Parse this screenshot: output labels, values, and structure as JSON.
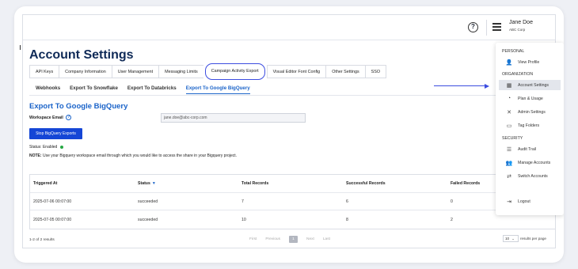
{
  "header": {
    "help_icon": "question-circle-icon",
    "menu_icon": "hamburger-icon",
    "user_name": "Jane Doe",
    "user_company": "ABC Corp"
  },
  "page": {
    "title": "Account Settings"
  },
  "tabs": [
    {
      "label": "API Keys",
      "active": false
    },
    {
      "label": "Company Information",
      "active": false
    },
    {
      "label": "User Management",
      "active": false
    },
    {
      "label": "Messaging Limits",
      "active": false
    },
    {
      "label": "Campaign Activity Export",
      "active": true
    },
    {
      "label": "Visual Editor Font Config",
      "active": false
    },
    {
      "label": "Other Settings",
      "active": false
    },
    {
      "label": "SSO",
      "active": false
    }
  ],
  "subtabs": [
    {
      "label": "Webhooks",
      "active": false
    },
    {
      "label": "Export To Snowflake",
      "active": false
    },
    {
      "label": "Export To Databricks",
      "active": false
    },
    {
      "label": "Export To Google BigQuery",
      "active": true
    }
  ],
  "export": {
    "title": "Export To Google BigQuery",
    "workspace_email_label": "Workspace Email",
    "workspace_email_value": "jane.doe@abc-corp.com",
    "stop_button_label": "Stop BigQuery Exports",
    "status_label": "Status:",
    "status_value": "Enabled",
    "status_color": "#27a844",
    "note_label": "NOTE:",
    "note_text": "Use your Bigquery workspace email through which you would like to access the share in your Bigquery project."
  },
  "table": {
    "columns": [
      "Triggered At",
      "Status",
      "Total Records",
      "Successful Records",
      "Failed Records"
    ],
    "rows": [
      [
        "2025-07-06 00:07:00",
        "succeeded",
        "7",
        "6",
        "0"
      ],
      [
        "2025-07-05 00:07:00",
        "succeeded",
        "10",
        "8",
        "2"
      ]
    ]
  },
  "pagination": {
    "range_text": "1-2 of 2 results",
    "first": "First",
    "previous": "Previous",
    "current_page": "1",
    "next": "Next",
    "last": "Last",
    "per_page_value": "10",
    "per_page_label": "results per page"
  },
  "menu": {
    "sections": {
      "personal": "PERSONAL",
      "organization": "ORGANIZATION",
      "security": "SECURITY"
    },
    "items": [
      {
        "label": "View Profile",
        "icon": "user-icon"
      },
      {
        "label": "Account Settings",
        "icon": "building-icon",
        "active": true
      },
      {
        "label": "Plan & Usage",
        "icon": "gauge-icon"
      },
      {
        "label": "Admin Settings",
        "icon": "tools-icon"
      },
      {
        "label": "Tag Folders",
        "icon": "folder-icon"
      },
      {
        "label": "Audit Trail",
        "icon": "audit-list-icon"
      },
      {
        "label": "Manage Accounts",
        "icon": "users-icon"
      },
      {
        "label": "Switch Accounts",
        "icon": "switch-arrows-icon"
      },
      {
        "label": "Logout",
        "icon": "logout-icon"
      }
    ]
  },
  "colors": {
    "accent": "#1a63c9",
    "button": "#1546d6",
    "title": "#0f2a57",
    "annotation": "#3c4de0"
  }
}
